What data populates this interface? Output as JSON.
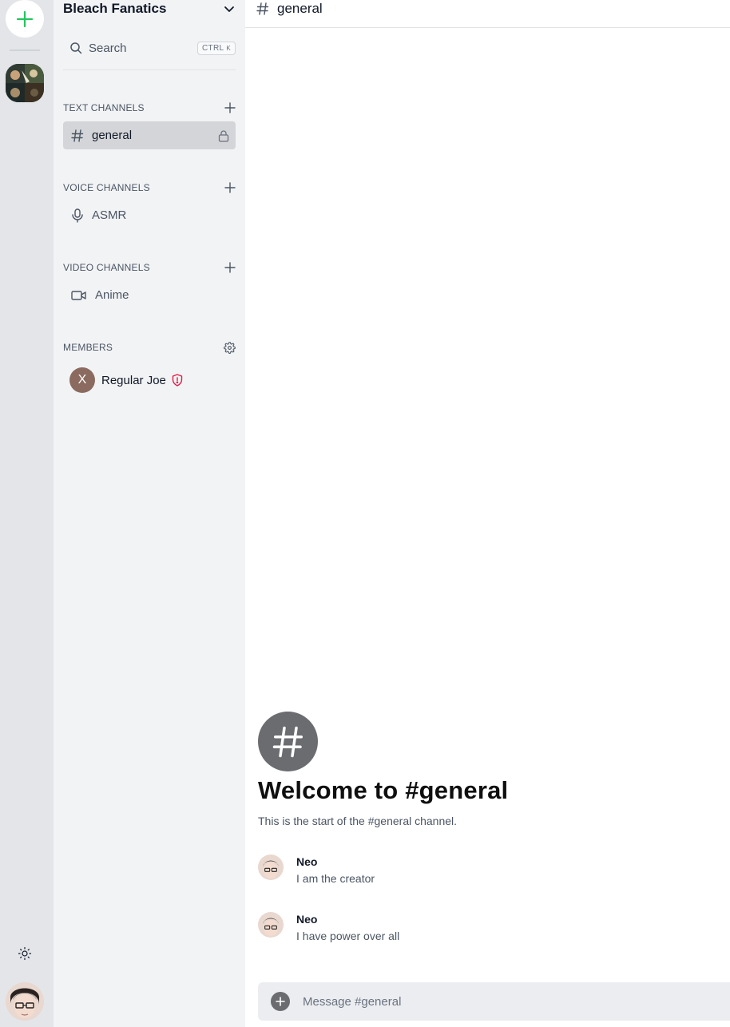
{
  "colors": {
    "accent": "#22c55e",
    "rail_bg": "#e3e5e8",
    "sidebar_bg": "#f2f3f5",
    "active_channel_bg": "#d4d5d8",
    "admin_badge": "#e11d48",
    "member_avatar_bg": "#8b6b5f"
  },
  "rail": {
    "add_server_icon": "plus-icon",
    "theme_icon": "sun-icon"
  },
  "sidebar": {
    "server_name": "Bleach Fanatics",
    "search": {
      "label": "Search",
      "shortcut_ctrl": "CTRL",
      "shortcut_key": "K"
    },
    "sections": {
      "text": {
        "title": "TEXT CHANNELS",
        "channels": [
          {
            "name": "general",
            "icon": "hash-icon",
            "active": true,
            "locked": true
          }
        ]
      },
      "voice": {
        "title": "VOICE CHANNELS",
        "channels": [
          {
            "name": "ASMR",
            "icon": "mic-icon"
          }
        ]
      },
      "video": {
        "title": "VIDEO CHANNELS",
        "channels": [
          {
            "name": "Anime",
            "icon": "video-icon"
          }
        ]
      },
      "members": {
        "title": "MEMBERS",
        "list": [
          {
            "initial": "X",
            "name": "Regular Joe",
            "badge": "shield-alert-icon"
          }
        ]
      }
    }
  },
  "main": {
    "channel_title": "general",
    "welcome": {
      "title": "Welcome to #general",
      "subtitle": "This is the start of the #general channel."
    },
    "messages": [
      {
        "author": "Neo",
        "content": "I am the creator"
      },
      {
        "author": "Neo",
        "content": "I have power over all"
      }
    ],
    "composer": {
      "placeholder": "Message #general"
    }
  }
}
